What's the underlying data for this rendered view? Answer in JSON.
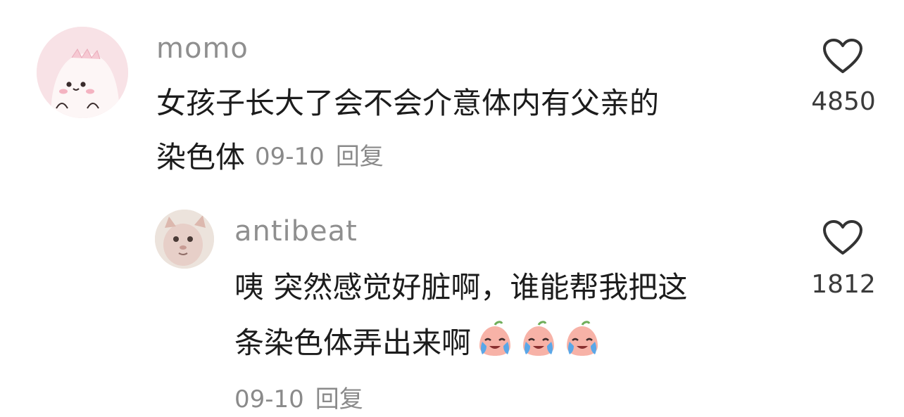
{
  "comments": [
    {
      "username": "momo",
      "avatar_icon": "pink-dinosaur-avatar",
      "text_line1": "女孩子长大了会不会介意体内有父亲的",
      "text_line2": "染色体",
      "date": "09-10",
      "reply_label": "回复",
      "like_icon": "heart-outline-icon",
      "like_count": "4850"
    },
    {
      "username": "antibeat",
      "avatar_icon": "hairless-cat-avatar",
      "text_line1": "咦 突然感觉好脏啊，谁能帮我把这",
      "text_line2": "条染色体弄出来啊",
      "emojis": [
        "crying-peach-emoji",
        "crying-peach-emoji",
        "crying-peach-emoji"
      ],
      "date": "09-10",
      "reply_label": "回复",
      "like_icon": "heart-outline-icon",
      "like_count": "1812"
    }
  ],
  "colors": {
    "background": "#ffffff",
    "username": "#8f8f8f",
    "text": "#1c1c1c",
    "meta": "#8a8a8a",
    "icon_stroke": "#333333"
  }
}
